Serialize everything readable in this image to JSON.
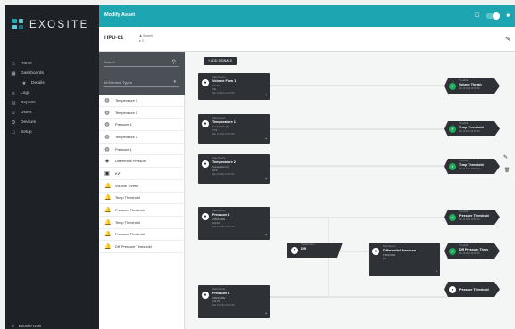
{
  "brand": {
    "name": "EXOSITE"
  },
  "nav": {
    "items": [
      {
        "label": "Home",
        "icon": "home-icon",
        "glyph": "⌂"
      },
      {
        "label": "Dashboards",
        "icon": "dashboard-icon",
        "glyph": "▦"
      },
      {
        "label": "Details",
        "icon": "star-icon",
        "glyph": "★",
        "sub": true
      },
      {
        "label": "Logs",
        "icon": "logs-icon",
        "glyph": "≡"
      },
      {
        "label": "Reports",
        "icon": "reports-icon",
        "glyph": "▤"
      },
      {
        "label": "Users",
        "icon": "users-icon",
        "glyph": "☺"
      },
      {
        "label": "Devices",
        "icon": "devices-icon",
        "glyph": "⚙"
      },
      {
        "label": "Setup",
        "icon": "setup-icon",
        "glyph": "□"
      }
    ],
    "footer": "Exosite User"
  },
  "topbar": {
    "title": "Modify Asset"
  },
  "asset": {
    "name": "HPU-01",
    "meta_line1": "Shared",
    "meta_line2": "3"
  },
  "panel": {
    "search_placeholder": "Search",
    "filter_value": "All Element Types",
    "types": [
      {
        "label": "Temperature 1",
        "icon": "gauge-icon",
        "glyph": "◍"
      },
      {
        "label": "Temperature 2",
        "icon": "gauge-icon",
        "glyph": "◍"
      },
      {
        "label": "Pressure 1",
        "icon": "gauge-icon",
        "glyph": "◍"
      },
      {
        "label": "Temperature 1",
        "icon": "gauge-icon",
        "glyph": "◍"
      },
      {
        "label": "Pressure 1",
        "icon": "gauge-icon",
        "glyph": "◍"
      },
      {
        "label": "Differential Pressure",
        "icon": "transform-icon",
        "glyph": "◈"
      },
      {
        "label": "KW",
        "icon": "chip-icon",
        "glyph": "▣"
      },
      {
        "label": "Volume Thresh",
        "icon": "bell-icon",
        "glyph": "🔔"
      },
      {
        "label": "Temp Threshold",
        "icon": "bell-icon",
        "glyph": "🔔"
      },
      {
        "label": "Pressure Threshold",
        "icon": "bell-icon",
        "glyph": "🔔"
      },
      {
        "label": "Temp Threshold",
        "icon": "bell-icon",
        "glyph": "🔔"
      },
      {
        "label": "Pressure Threshold",
        "icon": "bell-icon",
        "glyph": "🔔"
      },
      {
        "label": "Diff Pressure Threshold",
        "icon": "bell-icon",
        "glyph": "🔔"
      }
    ]
  },
  "canvas": {
    "add_button": "+ ADD SIGNALS",
    "sources": [
      {
        "kind": "Data Source",
        "title": "Volume Flow 1",
        "l3": "Control",
        "l4": "Cfs",
        "l5": "Mar 10 2021 12:00 PM"
      },
      {
        "kind": "Data Source",
        "title": "Temperature 1",
        "l3": "Temperature (F)",
        "l4": "77°F",
        "l5": "Mar 10 2021 12:00 PM"
      },
      {
        "kind": "Data Source",
        "title": "Temperature 2",
        "l3": "Temperature (F)",
        "l4": "62°F",
        "l5": "Mar 10 2021 12:00 PM"
      },
      {
        "kind": "Data Source",
        "title": "Pressure 1",
        "l3": "PRESSURE",
        "l4": "111 Psi",
        "l5": "Mar 10 2021 12:00 PM"
      },
      {
        "kind": "Data Source",
        "title": "Pressure 2",
        "l3": "PRESSURE",
        "l4": "121 Psi",
        "l5": "Mar 10 2021 12:00 PM"
      }
    ],
    "transform": {
      "kind": "Transformation",
      "title": "Diff",
      "glyph": "Σ"
    },
    "calc": {
      "kind": "Data Source",
      "title": "Differential Pressure",
      "l3": "PRESSURE",
      "l4": "Psi"
    },
    "rules": [
      {
        "kind": "Threshold",
        "title": "Volume Thresh",
        "sub": "Mar 10 2021 12:00 PM",
        "status": "ok"
      },
      {
        "kind": "Threshold",
        "title": "Temp Threshold",
        "sub": "Mar 10 2021 12:00 PM",
        "status": "ok"
      },
      {
        "kind": "Threshold",
        "title": "Temp Threshold",
        "sub": "Mar 10 2021 12:00 PM",
        "status": "ok"
      },
      {
        "kind": "Threshold",
        "title": "Pressure Threshold",
        "sub": "Mar 10 2021 12:00 PM",
        "status": "ok"
      },
      {
        "kind": "Threshold",
        "title": "Diff Pressure Thres",
        "sub": "Mar 10 2021 12:00 PM",
        "status": "ok"
      },
      {
        "kind": "",
        "title": "Pressure Threshold",
        "sub": "",
        "status": "idle"
      }
    ]
  },
  "colors": {
    "accent": "#1da6b2",
    "node": "#2e3237",
    "ok": "#1fae5a",
    "nav_bg": "#1e2227"
  }
}
